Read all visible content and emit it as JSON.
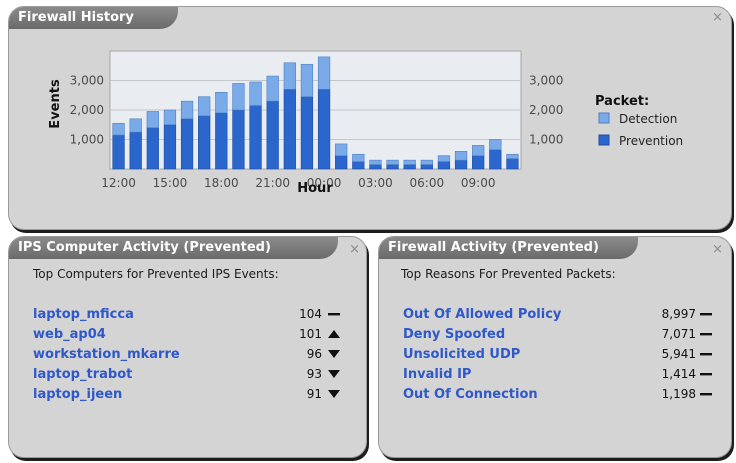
{
  "firewall_history": {
    "title": "Firewall History",
    "close": "×",
    "legend": {
      "title": "Packet:",
      "items": [
        {
          "label": "Detection",
          "color": "#7aaae8"
        },
        {
          "label": "Prevention",
          "color": "#2a66cc"
        }
      ]
    }
  },
  "chart_data": {
    "type": "bar",
    "stacked": true,
    "xlabel": "Hour",
    "ylabel": "Events",
    "ylim": [
      0,
      4000
    ],
    "y_ticks": [
      "1,000",
      "2,000",
      "3,000"
    ],
    "x_tick_labels": [
      "12:00",
      "15:00",
      "18:00",
      "21:00",
      "00:00",
      "03:00",
      "06:00",
      "09:00"
    ],
    "categories": [
      "12:00",
      "13:00",
      "14:00",
      "15:00",
      "16:00",
      "17:00",
      "18:00",
      "19:00",
      "20:00",
      "21:00",
      "22:00",
      "23:00",
      "00:00",
      "01:00",
      "02:00",
      "03:00",
      "04:00",
      "05:00",
      "06:00",
      "07:00",
      "08:00",
      "09:00",
      "10:00",
      "11:00"
    ],
    "series": [
      {
        "name": "Prevention",
        "values": [
          1150,
          1250,
          1400,
          1500,
          1700,
          1800,
          1900,
          2000,
          2150,
          2300,
          2700,
          2450,
          2700,
          450,
          250,
          150,
          150,
          150,
          150,
          250,
          300,
          450,
          650,
          350
        ]
      },
      {
        "name": "Detection",
        "values": [
          400,
          450,
          550,
          500,
          600,
          650,
          700,
          900,
          800,
          850,
          900,
          1100,
          1100,
          400,
          250,
          150,
          150,
          150,
          150,
          200,
          300,
          350,
          350,
          150
        ]
      }
    ],
    "grid": true,
    "legend_position": "right"
  },
  "ips_activity": {
    "title": "IPS Computer Activity (Prevented)",
    "close": "×",
    "subtitle": "Top Computers for Prevented IPS Events:",
    "rows": [
      {
        "name": "laptop_mficca",
        "count": "104",
        "trend": "flat"
      },
      {
        "name": "web_ap04",
        "count": "101",
        "trend": "up"
      },
      {
        "name": "workstation_mkarre",
        "count": "96",
        "trend": "down"
      },
      {
        "name": "laptop_trabot",
        "count": "93",
        "trend": "down"
      },
      {
        "name": "laptop_ijeen",
        "count": "91",
        "trend": "down"
      }
    ]
  },
  "firewall_activity": {
    "title": "Firewall Activity (Prevented)",
    "close": "×",
    "subtitle": "Top Reasons For Prevented Packets:",
    "rows": [
      {
        "name": "Out Of Allowed Policy",
        "count": "8,997",
        "trend": "flat"
      },
      {
        "name": "Deny Spoofed",
        "count": "7,071",
        "trend": "flat"
      },
      {
        "name": "Unsolicited UDP",
        "count": "5,941",
        "trend": "flat"
      },
      {
        "name": "Invalid IP",
        "count": "1,414",
        "trend": "flat"
      },
      {
        "name": "Out Of Connection",
        "count": "1,198",
        "trend": "flat"
      }
    ]
  }
}
